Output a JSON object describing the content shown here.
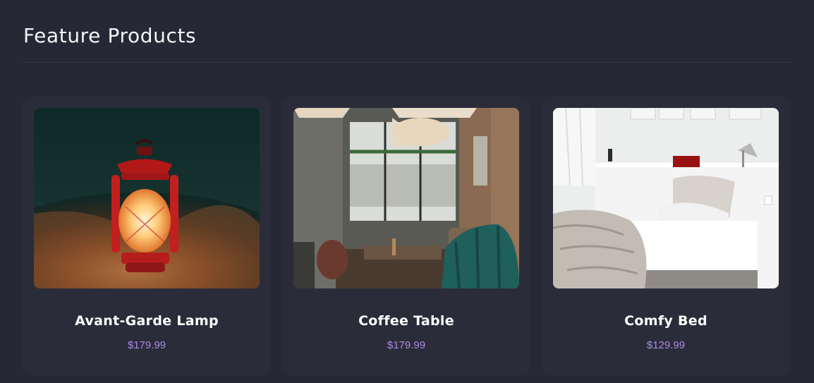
{
  "section": {
    "title": "Feature Products"
  },
  "products": [
    {
      "name": "Avant-Garde Lamp",
      "price": "$179.99",
      "image_icon": "lantern-image"
    },
    {
      "name": "Coffee Table",
      "price": "$179.99",
      "image_icon": "cafe-interior-image"
    },
    {
      "name": "Comfy Bed",
      "price": "$129.99",
      "image_icon": "bedroom-image"
    }
  ],
  "colors": {
    "background": "#262835",
    "card": "#2a2c39",
    "price": "#a98be6",
    "title": "#f4f5f8"
  }
}
